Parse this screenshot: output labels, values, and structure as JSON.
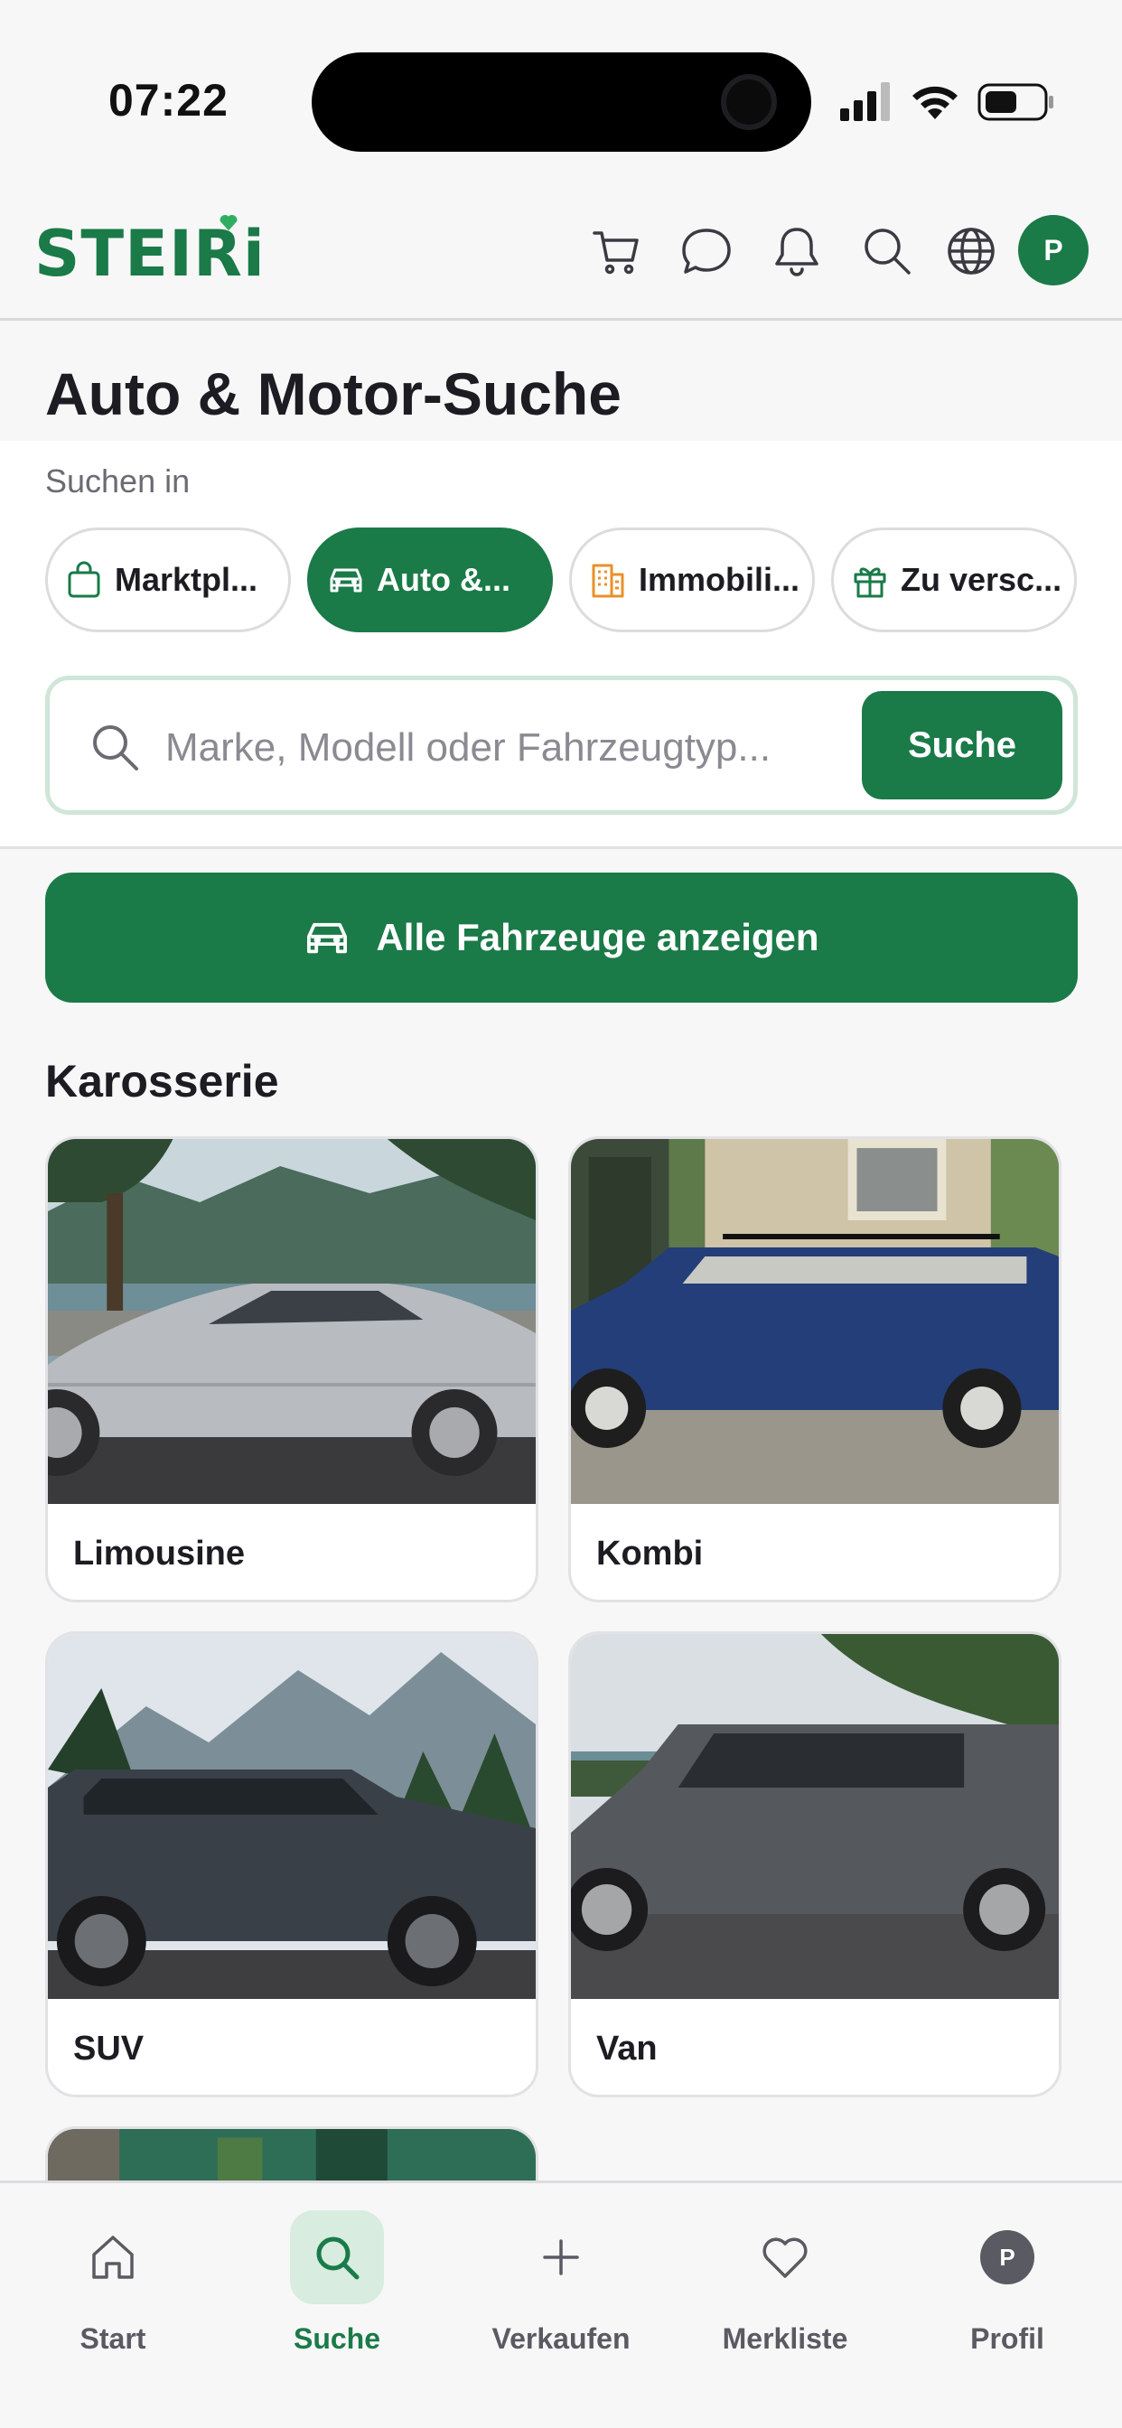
{
  "status_bar": {
    "time": "07:22"
  },
  "header": {
    "logo": "STEIRi",
    "avatar_initial": "P",
    "icons": [
      "cart-icon",
      "chat-icon",
      "bell-icon",
      "search-icon",
      "globe-icon"
    ]
  },
  "page": {
    "title": "Auto & Motor-Suche",
    "search_in_label": "Suchen in"
  },
  "categories": [
    {
      "label": "Marktpl...",
      "icon": "bag-icon",
      "active": false
    },
    {
      "label": "Auto &...",
      "icon": "car-icon",
      "active": true
    },
    {
      "label": "Immobili...",
      "icon": "building-icon",
      "active": false
    },
    {
      "label": "Zu versc...",
      "icon": "gift-icon",
      "active": false
    }
  ],
  "search": {
    "placeholder": "Marke, Modell oder Fahrzeugtyp...",
    "button_label": "Suche"
  },
  "all_vehicles_button": "Alle Fahrzeuge anzeigen",
  "body_section": {
    "title": "Karosserie",
    "cards": [
      {
        "label": "Limousine"
      },
      {
        "label": "Kombi"
      },
      {
        "label": "SUV"
      },
      {
        "label": "Van"
      }
    ]
  },
  "bottom_nav": [
    {
      "label": "Start",
      "icon": "home-icon",
      "active": false
    },
    {
      "label": "Suche",
      "icon": "search-icon",
      "active": true
    },
    {
      "label": "Verkaufen",
      "icon": "plus-icon",
      "active": false
    },
    {
      "label": "Merkliste",
      "icon": "heart-icon",
      "active": false
    },
    {
      "label": "Profil",
      "icon": "avatar",
      "initial": "P",
      "active": false
    }
  ],
  "colors": {
    "brand_green": "#1a7a48",
    "active_tab_bg": "#d8ece0",
    "chip_border": "#dcdce0"
  }
}
